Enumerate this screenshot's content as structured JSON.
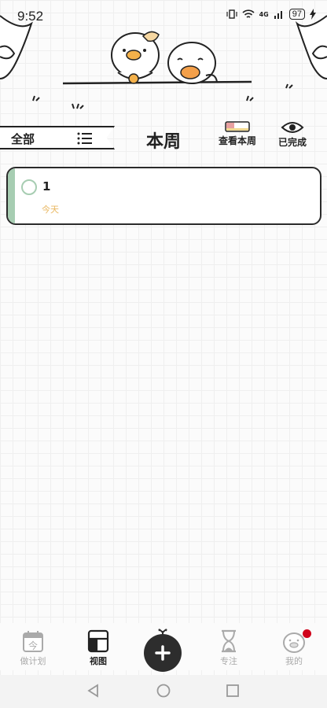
{
  "status_bar": {
    "time": "9:52",
    "signal_label": "4G",
    "battery": "97"
  },
  "toolbar": {
    "filter_label": "全部",
    "page_title": "本周",
    "view_week_label": "查看本周",
    "completed_label": "已完成"
  },
  "tasks": [
    {
      "title": "1",
      "date_label": "今天",
      "accent_color": "#a7cdb2",
      "date_color": "#e9b760"
    }
  ],
  "bottom_nav": {
    "items": [
      {
        "label": "做计划",
        "icon": "calendar-icon",
        "glyph": "今"
      },
      {
        "label": "视图",
        "icon": "view-layout-icon"
      },
      {
        "label": "专注",
        "icon": "hourglass-icon"
      },
      {
        "label": "我的",
        "icon": "duck-avatar-icon"
      }
    ],
    "fab_icon": "plus-icon"
  },
  "system_nav": [
    "back",
    "home",
    "recents"
  ],
  "colors": {
    "accent_green": "#a7cdb2",
    "date_orange": "#e9b760",
    "badge_red": "#d0021b",
    "dark": "#2d2d2d"
  }
}
